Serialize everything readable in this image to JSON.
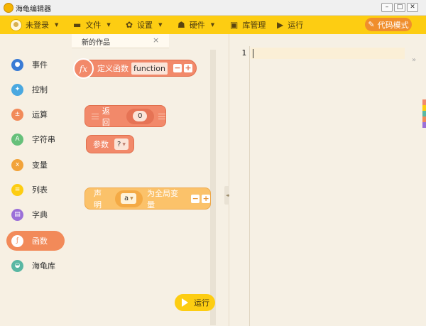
{
  "window": {
    "title": "海龟编辑器",
    "min": "–",
    "max": "□",
    "close": "✕"
  },
  "toolbar": {
    "user_label": "未登录",
    "file_label": "文件",
    "settings_label": "设置",
    "hardware_label": "硬件",
    "library_label": "库管理",
    "run_label": "运行",
    "code_mode_label": "代码模式"
  },
  "categories": [
    {
      "label": "事件",
      "icon": "toggle-icon",
      "color": "#3a7bd5",
      "glyph": "●"
    },
    {
      "label": "控制",
      "icon": "gamepad-icon",
      "color": "#4aa8e0",
      "glyph": "✦"
    },
    {
      "label": "运算",
      "icon": "calculator-icon",
      "color": "#f28a59",
      "glyph": "±"
    },
    {
      "label": "字符串",
      "icon": "letter-a-icon",
      "color": "#66c07a",
      "glyph": "A"
    },
    {
      "label": "变量",
      "icon": "variable-x-icon",
      "color": "#f2a33a",
      "glyph": "x"
    },
    {
      "label": "列表",
      "icon": "list-icon",
      "color": "#fdcd12",
      "glyph": "≡"
    },
    {
      "label": "字典",
      "icon": "book-icon",
      "color": "#9b70d8",
      "glyph": "▤"
    },
    {
      "label": "函数",
      "icon": "function-icon",
      "color": "#f2896a",
      "glyph": "ƒ"
    },
    {
      "label": "海龟库",
      "icon": "turtle-icon",
      "color": "#59b7a3",
      "glyph": "◒"
    }
  ],
  "active_category": "函数",
  "tab": {
    "label": "新的作品",
    "close": "×"
  },
  "blocks": {
    "define_label": "定义函数",
    "function_name": "function",
    "fx_glyph": "fx",
    "minus": "−",
    "plus": "+",
    "return_label": "返回",
    "return_value": "0",
    "param_label": "参数",
    "param_value": "?",
    "declare_label": "声明",
    "declare_var": "a",
    "declare_suffix": "为全局变量"
  },
  "run_button_label": "运行",
  "editor": {
    "line_number": "1",
    "expand_glyph": "»"
  }
}
